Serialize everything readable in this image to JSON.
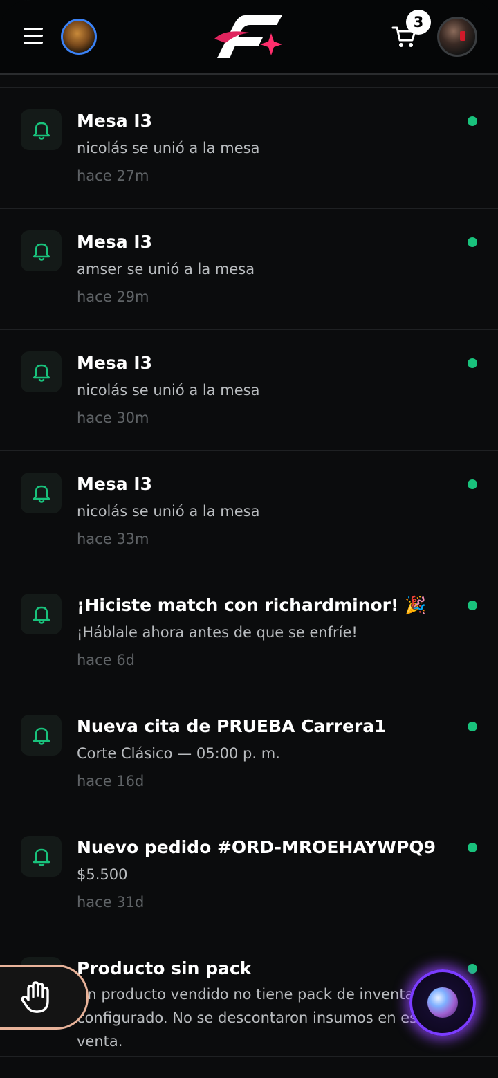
{
  "header": {
    "cart_count": "3",
    "icons": {
      "menu": "hamburger-icon",
      "cart": "cart-icon",
      "logo": "brand-logo"
    }
  },
  "notifications": [
    {
      "title": "",
      "body": "amser se unió a la mesa",
      "time": "hace 27m",
      "unread": false
    },
    {
      "title": "Mesa I3",
      "body": "nicolás se unió a la mesa",
      "time": "hace 27m",
      "unread": true
    },
    {
      "title": "Mesa I3",
      "body": "amser se unió a la mesa",
      "time": "hace 29m",
      "unread": true
    },
    {
      "title": "Mesa I3",
      "body": "nicolás se unió a la mesa",
      "time": "hace 30m",
      "unread": true
    },
    {
      "title": "Mesa I3",
      "body": "nicolás se unió a la mesa",
      "time": "hace 33m",
      "unread": true
    },
    {
      "title": "¡Hiciste match con richardminor! 🎉",
      "body": "¡Háblale ahora antes de que se enfríe!",
      "time": "hace 6d",
      "unread": true
    },
    {
      "title": "Nueva cita de PRUEBA Carrera1",
      "body": "Corte Clásico — 05:00 p. m.",
      "time": "hace 16d",
      "unread": true
    },
    {
      "title": "Nuevo pedido #ORD-MROEHAYWPQ9",
      "body": "$5.500",
      "time": "hace 31d",
      "unread": true
    },
    {
      "title": "Producto sin pack",
      "body": "Un producto vendido no tiene pack de inventario configurado. No se descontaron insumos en esta venta.",
      "time": "",
      "unread": true
    }
  ],
  "colors": {
    "accent_green": "#19c27c",
    "background": "#0b0c0d",
    "orb_glow": "#7b3cff"
  }
}
